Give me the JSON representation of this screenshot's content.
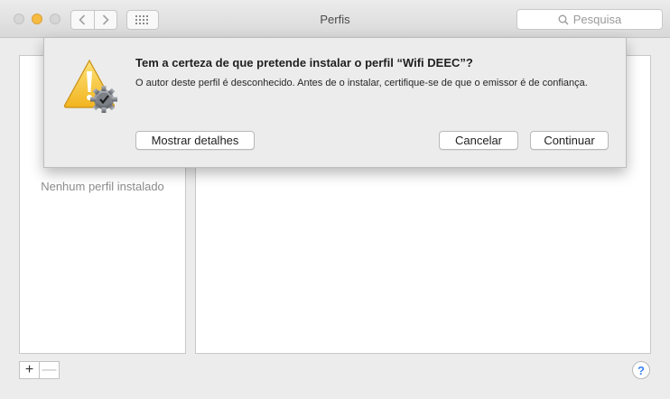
{
  "window": {
    "title": "Perfis"
  },
  "toolbar": {
    "back_icon": "chevron-left-icon",
    "forward_icon": "chevron-right-icon",
    "grid_icon": "grid-dots-icon",
    "search_placeholder": "Pesquisa",
    "search_icon": "magnifier-icon"
  },
  "profiles": {
    "empty_text": "Nenhum perfil instalado"
  },
  "footer": {
    "add_label": "+",
    "remove_label": "—",
    "help_label": "?"
  },
  "dialog": {
    "icon": "warning-triangle-with-gear-check-icon",
    "heading": "Tem a certeza de que pretende instalar o perfil “Wifi DEEC”?",
    "message": "O autor deste perfil é desconhecido. Antes de o instalar, certifique-se de que o emissor é de confiança.",
    "show_details_label": "Mostrar detalhes",
    "cancel_label": "Cancelar",
    "continue_label": "Continuar"
  },
  "colors": {
    "accent": "#3b82f6",
    "warning": "#f6c43a",
    "minimize": "#f6bb42"
  }
}
